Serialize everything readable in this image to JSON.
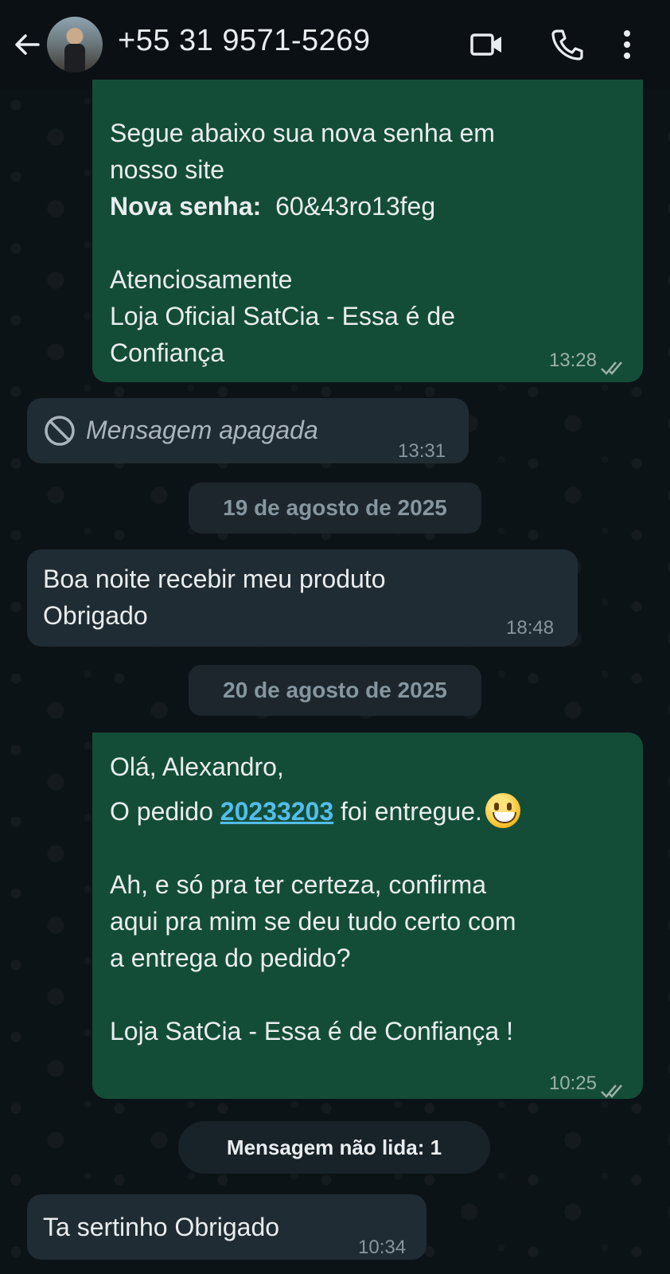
{
  "header": {
    "contact_name": "+55 31 9571-5269"
  },
  "messages": {
    "m1": {
      "line1": "Segue abaixo sua nova senha em",
      "line2": "nosso site",
      "password_label": "Nova senha:",
      "password_value": "60&43ro13feg",
      "closing": "Atenciosamente",
      "signature1": "Loja Oficial SatCia - Essa é de",
      "signature2": "Confiança",
      "time": "13:28"
    },
    "m2": {
      "text": "Mensagem apagada",
      "time": "13:31"
    },
    "date1": "19 de agosto de 2025",
    "m3": {
      "line1": "Boa noite recebir meu produto",
      "line2": "Obrigado",
      "time": "18:48"
    },
    "date2": "20 de agosto de 2025",
    "m4": {
      "greeting": "Olá, Alexandro,",
      "order_prefix": "O pedido ",
      "order_number": "20233203",
      "order_suffix": " foi entregue.",
      "line3": "Ah, e só pra ter certeza, confirma",
      "line4": "aqui pra mim se deu tudo certo com",
      "line5": "a entrega do pedido?",
      "signature": "Loja SatCia - Essa é de Confiança !",
      "time": "10:25"
    },
    "unread_banner": "Mensagem não lida: 1",
    "m5": {
      "text": "Ta sertinho Obrigado",
      "time": "10:34"
    }
  },
  "colors": {
    "outgoing_bubble": "#144d37",
    "incoming_bubble": "#202c33",
    "link": "#53bdeb",
    "background": "#0b1014"
  }
}
